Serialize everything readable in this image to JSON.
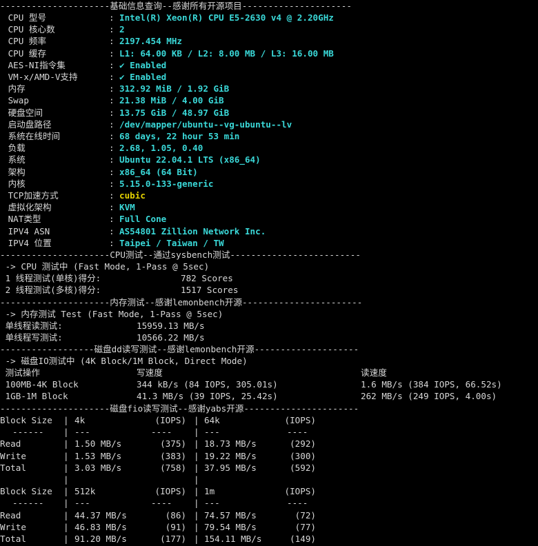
{
  "sections": {
    "basic": "---------------------基础信息查询--感谢所有开源项目---------------------",
    "cpu": "---------------------CPU测试--通过sysbench测试-------------------------",
    "mem": "---------------------内存测试--感谢lemonbench开源-----------------------",
    "dd": "------------------磁盘dd读写测试--感谢lemonbench开源--------------------",
    "fio": "---------------------磁盘fio读写测试--感谢yabs开源----------------------"
  },
  "info": [
    {
      "label": " CPU 型号",
      "value": "Intel(R) Xeon(R) CPU E5-2630 v4 @ 2.20GHz",
      "style": "c"
    },
    {
      "label": " CPU 核心数",
      "value": "2",
      "style": "c"
    },
    {
      "label": " CPU 频率",
      "value": "2197.454 MHz",
      "style": "c"
    },
    {
      "label": " CPU 缓存",
      "value": "L1: 64.00 KB / L2: 8.00 MB / L3: 16.00 MB",
      "style": "c"
    },
    {
      "label": " AES-NI指令集",
      "value": "✔ Enabled",
      "style": "c"
    },
    {
      "label": " VM-x/AMD-V支持",
      "value": "✔ Enabled",
      "style": "c"
    },
    {
      "label": " 内存",
      "value": "312.92 MiB / 1.92 GiB",
      "style": "c"
    },
    {
      "label": " Swap",
      "value": "21.38 MiB / 4.00 GiB",
      "style": "c"
    },
    {
      "label": " 硬盘空间",
      "value": "13.75 GiB / 48.97 GiB",
      "style": "c"
    },
    {
      "label": " 启动盘路径",
      "value": "/dev/mapper/ubuntu--vg-ubuntu--lv",
      "style": "c"
    },
    {
      "label": " 系统在线时间",
      "value": "68 days, 22 hour 53 min",
      "style": "c"
    },
    {
      "label": " 负载",
      "value": "2.68, 1.05, 0.40",
      "style": "c"
    },
    {
      "label": " 系统",
      "value": "Ubuntu 22.04.1 LTS (x86_64)",
      "style": "c"
    },
    {
      "label": " 架构",
      "value": "x86_64 (64 Bit)",
      "style": "c"
    },
    {
      "label": " 内核",
      "value": "5.15.0-133-generic",
      "style": "c"
    },
    {
      "label": " TCP加速方式",
      "value": "cubic",
      "style": "y"
    },
    {
      "label": " 虚拟化架构",
      "value": "KVM",
      "style": "c"
    },
    {
      "label": " NAT类型",
      "value": "Full Cone",
      "style": "c"
    },
    {
      "label": " IPV4 ASN",
      "value": "AS54801 Zillion Network Inc.",
      "style": "c"
    },
    {
      "label": " IPV4 位置",
      "value": "Taipei / Taiwan / TW",
      "style": "c"
    }
  ],
  "separator": ":",
  "cpu_test": {
    "header": " -> CPU 测试中 (Fast Mode, 1-Pass @ 5sec)",
    "rows": [
      {
        "label": " 1 线程测试(单核)得分:",
        "value": "782 Scores"
      },
      {
        "label": " 2 线程测试(多核)得分:",
        "value": "1517 Scores"
      }
    ]
  },
  "mem_test": {
    "header": " -> 内存测试 Test (Fast Mode, 1-Pass @ 5sec)",
    "rows": [
      {
        "label": " 单线程读测试:",
        "value": "15959.13 MB/s"
      },
      {
        "label": " 单线程写测试:",
        "value": "10566.22 MB/s"
      }
    ]
  },
  "dd_test": {
    "header": " -> 磁盘IO测试中 (4K Block/1M Block, Direct Mode)",
    "columns": [
      " 测试操作",
      "写速度",
      "读速度"
    ],
    "rows": [
      [
        " 100MB-4K Block",
        "344 kB/s (84 IOPS, 305.01s)",
        "1.6 MB/s (384 IOPS, 66.52s)"
      ],
      [
        " 1GB-1M Block",
        "41.3 MB/s (39 IOPS, 25.42s)",
        "262 MB/s (249 IOPS, 4.00s)"
      ]
    ]
  },
  "fio": {
    "blocks": [
      {
        "head": [
          "Block Size",
          "4k",
          "(IOPS)",
          "64k",
          "(IOPS)"
        ],
        "dash": [
          "------",
          "---",
          "----",
          "---",
          "----"
        ],
        "rows": [
          [
            "Read",
            "1.50 MB/s",
            "(375)",
            "18.73 MB/s",
            "(292)"
          ],
          [
            "Write",
            "1.53 MB/s",
            "(383)",
            "19.22 MB/s",
            "(300)"
          ],
          [
            "Total",
            "3.03 MB/s",
            "(758)",
            "37.95 MB/s",
            "(592)"
          ]
        ]
      },
      {
        "head": [
          "Block Size",
          "512k",
          "(IOPS)",
          "1m",
          "(IOPS)"
        ],
        "dash": [
          "------",
          "---",
          "----",
          "---",
          "----"
        ],
        "rows": [
          [
            "Read",
            "44.37 MB/s",
            "(86)",
            "74.57 MB/s",
            "(72)"
          ],
          [
            "Write",
            "46.83 MB/s",
            "(91)",
            "79.54 MB/s",
            "(77)"
          ],
          [
            "Total",
            "91.20 MB/s",
            "(177)",
            "154.11 MB/s",
            "(149)"
          ]
        ]
      }
    ],
    "pipe": "|"
  },
  "colors": {
    "value": "#3ad8d8",
    "tcp": "#e5d200",
    "text": "#d8d8d8",
    "bg": "#000000"
  }
}
